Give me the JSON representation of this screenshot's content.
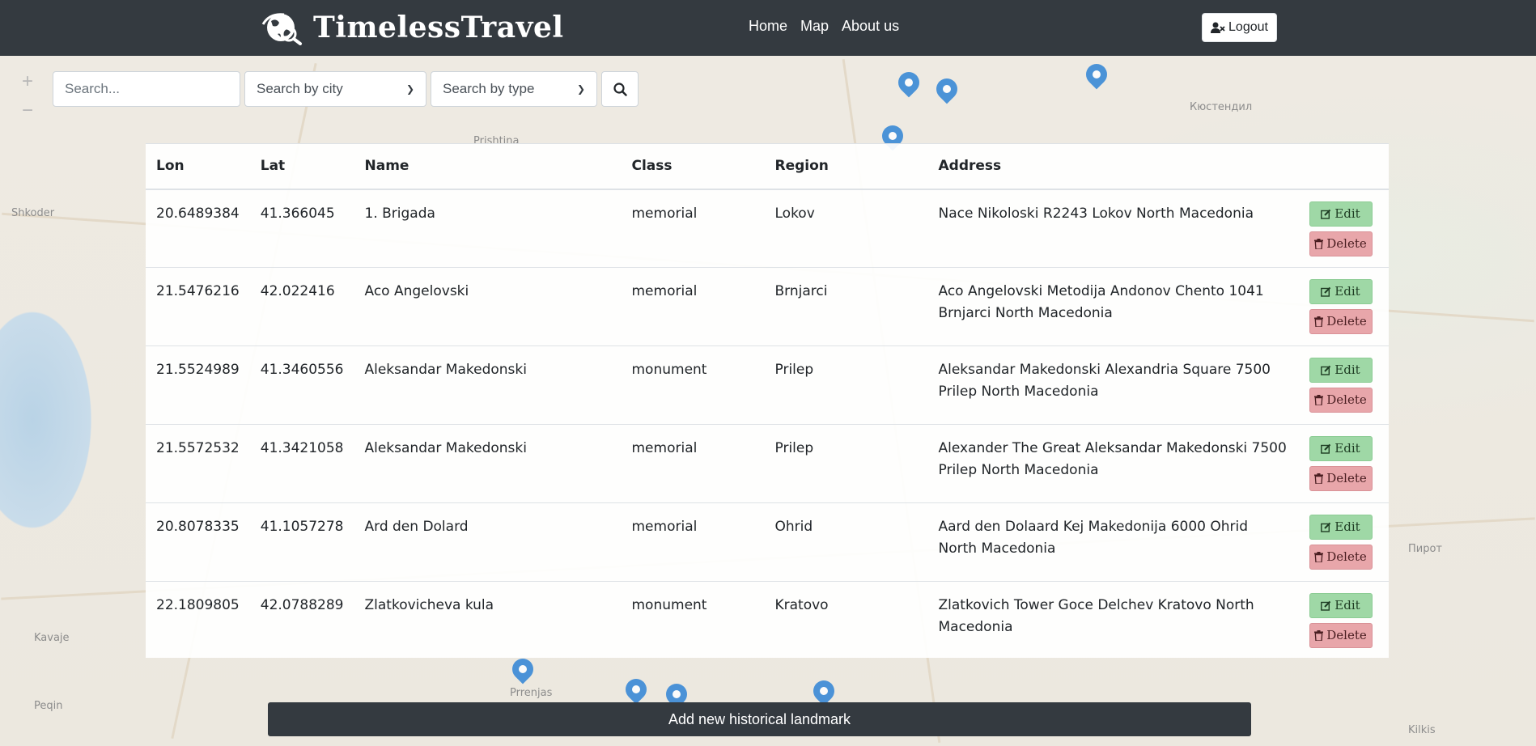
{
  "brand": {
    "name": "TimelessTravel"
  },
  "nav": {
    "links": [
      {
        "label": "Home"
      },
      {
        "label": "Map"
      },
      {
        "label": "About us"
      }
    ],
    "logout_label": "Logout"
  },
  "map": {
    "zoom_in": "+",
    "zoom_out": "−",
    "labels": [
      "Shkoder",
      "Prishtina",
      "Кюстендил",
      "Kavaje",
      "Peqin",
      "Prrenjas",
      "Пирот",
      "Kilkis"
    ]
  },
  "search": {
    "placeholder": "Search...",
    "city_select": "Search by city",
    "type_select": "Search by type"
  },
  "table": {
    "headers": [
      "Lon",
      "Lat",
      "Name",
      "Class",
      "Region",
      "Address",
      ""
    ],
    "edit_label": "Edit",
    "delete_label": "Delete",
    "rows": [
      {
        "lon": "20.6489384",
        "lat": "41.366045",
        "name": "1. Brigada",
        "class": "memorial",
        "region": "Lokov",
        "address": "Nace Nikoloski R2243 Lokov North Macedonia"
      },
      {
        "lon": "21.5476216",
        "lat": "42.022416",
        "name": "Aco Angelovski",
        "class": "memorial",
        "region": "Brnjarci",
        "address": "Aco Angelovski Metodija Andonov Chento 1041 Brnjarci North Macedonia"
      },
      {
        "lon": "21.5524989",
        "lat": "41.3460556",
        "name": "Aleksandar Makedonski",
        "class": "monument",
        "region": "Prilep",
        "address": "Aleksandar Makedonski Alexandria Square 7500 Prilep North Macedonia"
      },
      {
        "lon": "21.5572532",
        "lat": "41.3421058",
        "name": "Aleksandar Makedonski",
        "class": "memorial",
        "region": "Prilep",
        "address": "Alexander The Great Aleksandar Makedonski 7500 Prilep North Macedonia"
      },
      {
        "lon": "20.8078335",
        "lat": "41.1057278",
        "name": "Ard den Dolard",
        "class": "memorial",
        "region": "Ohrid",
        "address": "Aard den Dolaard Kej Makedonija 6000 Ohrid North Macedonia"
      },
      {
        "lon": "22.1809805",
        "lat": "42.0788289",
        "name": "Zlatkovicheva kula",
        "class": "monument",
        "region": "Kratovo",
        "address": "Zlatkovich Tower Goce Delchev Kratovo North Macedonia"
      }
    ]
  },
  "add_button": {
    "label": "Add new historical landmark"
  },
  "colors": {
    "navbar": "#343a40",
    "edit": "#9fd8a6",
    "delete": "#e8a6aa",
    "map_pin": "#2f84d6"
  }
}
